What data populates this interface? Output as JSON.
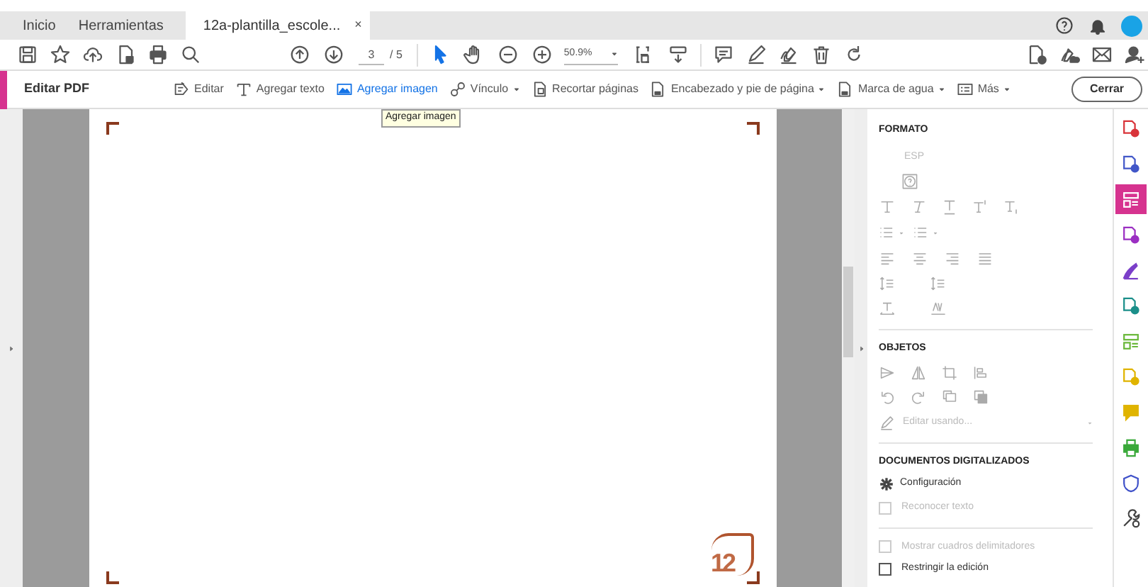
{
  "tabs": [
    {
      "label": "Inicio",
      "selected": false
    },
    {
      "label": "Herramientas",
      "selected": false
    },
    {
      "label": "12a-plantilla_escole...",
      "selected": true
    }
  ],
  "tab_close": "×",
  "toolbar": {
    "page": "3",
    "page_total": "/ 5",
    "zoom": "50.9%"
  },
  "edit_bar": {
    "title": "Editar PDF",
    "close_button": "Cerrar",
    "tools": [
      {
        "label": "Editar",
        "selected": false,
        "dropdown": false
      },
      {
        "label": "Agregar texto",
        "selected": false,
        "dropdown": false
      },
      {
        "label": "Agregar imagen",
        "selected": true,
        "dropdown": false
      },
      {
        "label": "Vínculo",
        "selected": false,
        "dropdown": true
      },
      {
        "label": "Recortar páginas",
        "selected": false,
        "dropdown": false
      },
      {
        "label": "Encabezado y pie de página",
        "selected": false,
        "dropdown": true
      },
      {
        "label": "Marca de agua",
        "selected": false,
        "dropdown": true
      },
      {
        "label": "Más",
        "selected": false,
        "dropdown": true
      }
    ]
  },
  "tooltip": "Agregar imagen",
  "document": {
    "logo_text": "12"
  },
  "panel": {
    "formato_title": "FORMATO",
    "language": {
      "label": "ESP",
      "disabled": true
    },
    "objetos_title": "OBJETOS",
    "edit_with": {
      "label": "Editar usando...",
      "disabled": true
    },
    "scanned_title": "DOCUMENTOS DIGITALIZADOS",
    "settings": "Configuración",
    "options": [
      {
        "label": "Reconocer texto",
        "checked": false,
        "disabled": true
      },
      {
        "label": "Mostrar cuadros delimitadores",
        "checked": false,
        "disabled": true
      },
      {
        "label": "Restringir la edición",
        "checked": false,
        "disabled": false
      }
    ]
  },
  "rail": [
    {
      "kind": "document",
      "color": "#d9343a",
      "selected": false
    },
    {
      "kind": "document",
      "color": "#4257c8",
      "selected": false
    },
    {
      "kind": "layout",
      "color": "#d6338f",
      "selected": true
    },
    {
      "kind": "document",
      "color": "#9b2fc2",
      "selected": false
    },
    {
      "kind": "pen",
      "color": "#7b3fc9",
      "selected": false
    },
    {
      "kind": "document",
      "color": "#1b8f8a",
      "selected": false
    },
    {
      "kind": "layout",
      "color": "#6ab83a",
      "selected": false
    },
    {
      "kind": "document",
      "color": "#e0b400",
      "selected": false
    },
    {
      "kind": "comment",
      "color": "#e0b400",
      "selected": false
    },
    {
      "kind": "printer",
      "color": "#3aa93a",
      "selected": false
    },
    {
      "kind": "shield",
      "color": "#3f51c9",
      "selected": false
    },
    {
      "kind": "tool",
      "color": "#444444",
      "selected": false
    }
  ]
}
